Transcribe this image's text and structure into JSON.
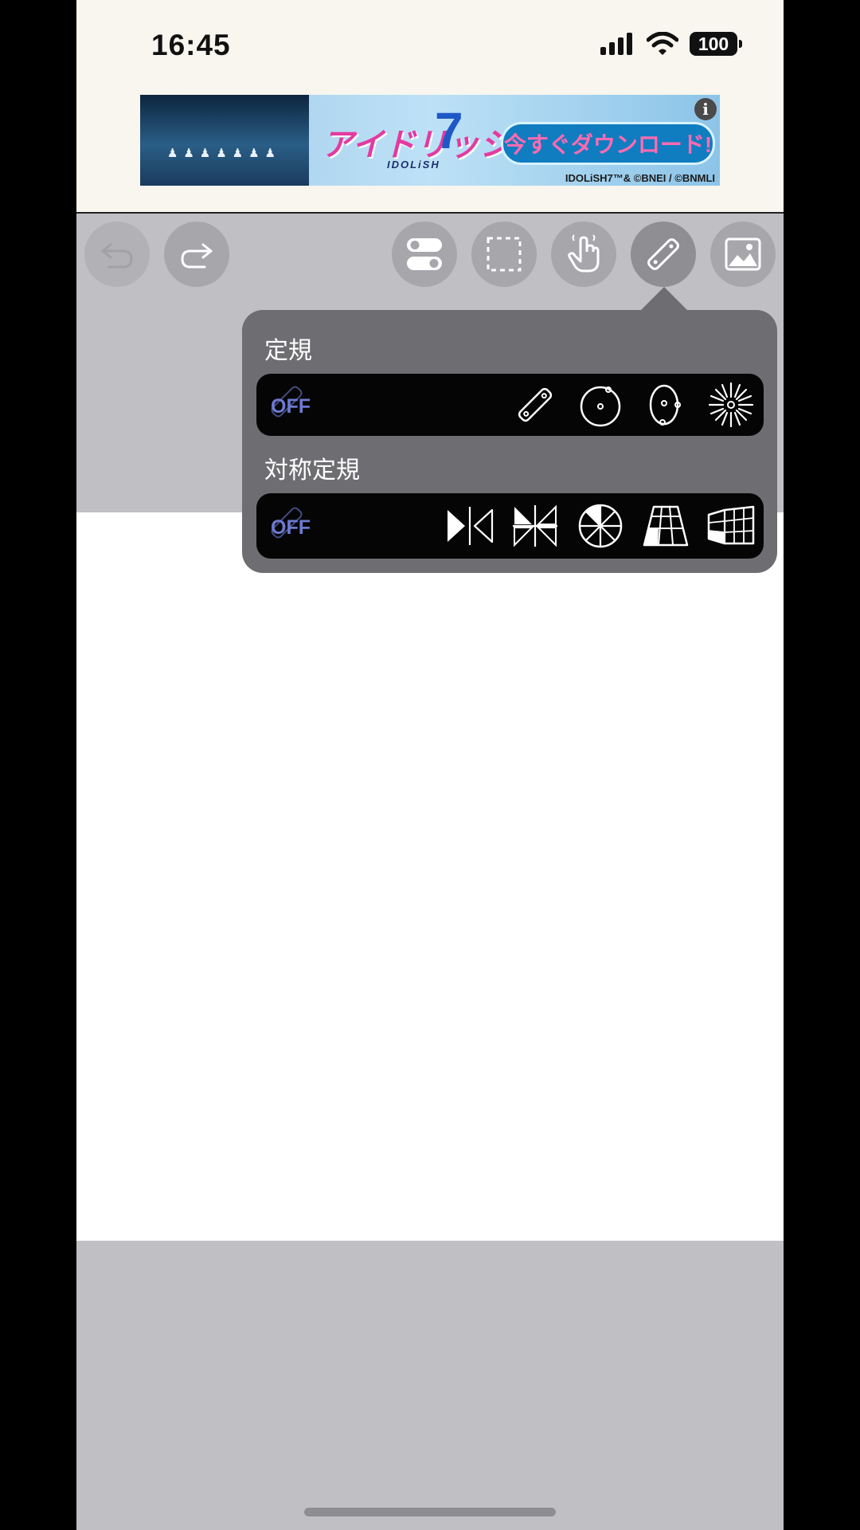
{
  "status_bar": {
    "time": "16:45",
    "battery": "100",
    "icons": [
      "cellular-signal-icon",
      "wifi-icon",
      "battery-icon"
    ]
  },
  "ad": {
    "logo_text": "アイドリッシュセブン",
    "logo_sub": "IDOLiSH",
    "logo_number": "7",
    "cta": "今すぐダウンロード!",
    "copyright": "IDOLiSH7™& ©BNEI / ©BNMLI",
    "info": "i"
  },
  "toolbar": {
    "items": [
      {
        "name": "undo",
        "icon": "undo-icon",
        "enabled": false
      },
      {
        "name": "redo",
        "icon": "redo-icon",
        "enabled": true
      },
      {
        "name": "toggle-settings",
        "icon": "toggle-icon",
        "enabled": true
      },
      {
        "name": "selection",
        "icon": "marquee-select-icon",
        "enabled": true
      },
      {
        "name": "touch",
        "icon": "hand-touch-icon",
        "enabled": true
      },
      {
        "name": "ruler",
        "icon": "ruler-icon",
        "enabled": true,
        "active": true
      },
      {
        "name": "image",
        "icon": "image-icon",
        "enabled": true
      }
    ]
  },
  "ruler_popover": {
    "ruler_section": {
      "label": "定規",
      "off_label": "OFF",
      "options": [
        "straight-ruler-icon",
        "circle-ruler-icon",
        "ellipse-ruler-icon",
        "radial-ruler-icon"
      ]
    },
    "symmetry_section": {
      "label": "対称定規",
      "off_label": "OFF",
      "options": [
        "mirror-symmetry-icon",
        "quad-symmetry-icon",
        "rotational-symmetry-icon",
        "one-point-perspective-icon",
        "two-point-perspective-icon"
      ]
    }
  },
  "colors": {
    "status_bg": "#f8f6ef",
    "workspace_bg": "#c0bfc3",
    "popover_bg": "#6e6d71",
    "strip_bg": "#050505",
    "off_color": "#6d7ad1"
  }
}
